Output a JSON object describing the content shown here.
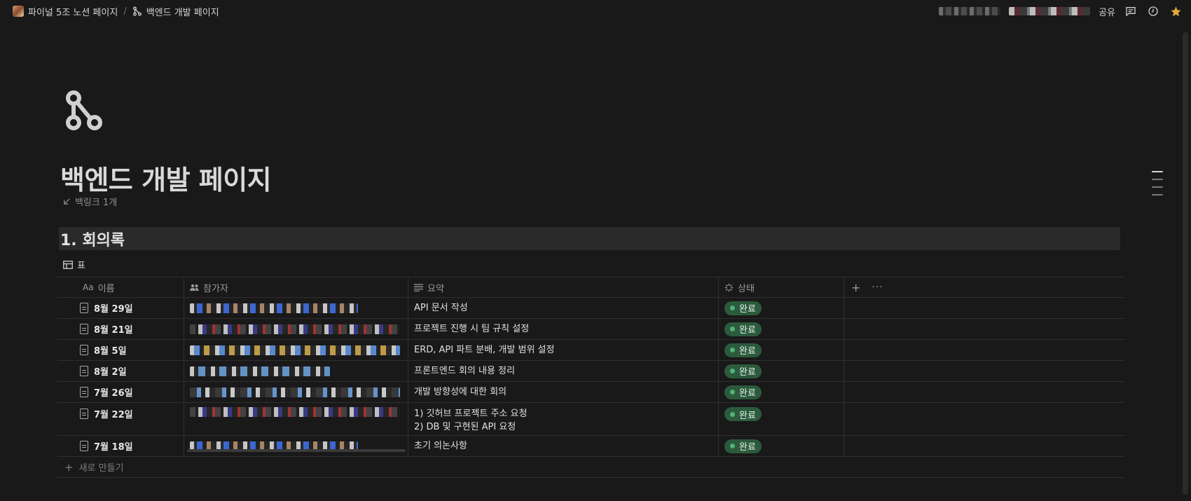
{
  "breadcrumb": {
    "workspace": "파이널 5조 노션 페이지",
    "separator": "/",
    "current": "백엔드 개발 페이지"
  },
  "topbar": {
    "share_label": "공유"
  },
  "page": {
    "title": "백엔드 개발 페이지",
    "backlinks": "백링크 1개",
    "section_heading": "1. 회의록",
    "view_name": "표"
  },
  "table": {
    "columns": [
      {
        "label": "이름",
        "icon": "Aa"
      },
      {
        "label": "참가자",
        "icon": "people-icon"
      },
      {
        "label": "요약",
        "icon": "lines-icon"
      },
      {
        "label": "상태",
        "icon": "status-icon"
      }
    ],
    "rows": [
      {
        "name": "8월 29일",
        "summary": [
          "API 문서 작성"
        ],
        "status": "완료"
      },
      {
        "name": "8월 21일",
        "summary": [
          "프로젝트 진행 시 팀 규칙 설정"
        ],
        "status": "완료"
      },
      {
        "name": "8월 5일",
        "summary": [
          "ERD, API 파트 분배, 개발 범위 설정"
        ],
        "status": "완료"
      },
      {
        "name": "8월 2일",
        "summary": [
          "프론트엔드 회의 내용 정리"
        ],
        "status": "완료"
      },
      {
        "name": "7월 26일",
        "summary": [
          "개발 방향성에 대한 회의"
        ],
        "status": "완료"
      },
      {
        "name": "7월 22일",
        "summary": [
          "1) 깃허브 프로젝트 주소 요청",
          "2) DB 및 구현된 API 요청"
        ],
        "status": "완료"
      },
      {
        "name": "7월 18일",
        "summary": [
          "초기 의논사항"
        ],
        "status": "완료"
      }
    ],
    "new_row_label": "새로 만들기"
  },
  "colors": {
    "background": "#191919",
    "status_done_bg": "#2b5a3c",
    "status_done_dot": "#4fb477"
  }
}
